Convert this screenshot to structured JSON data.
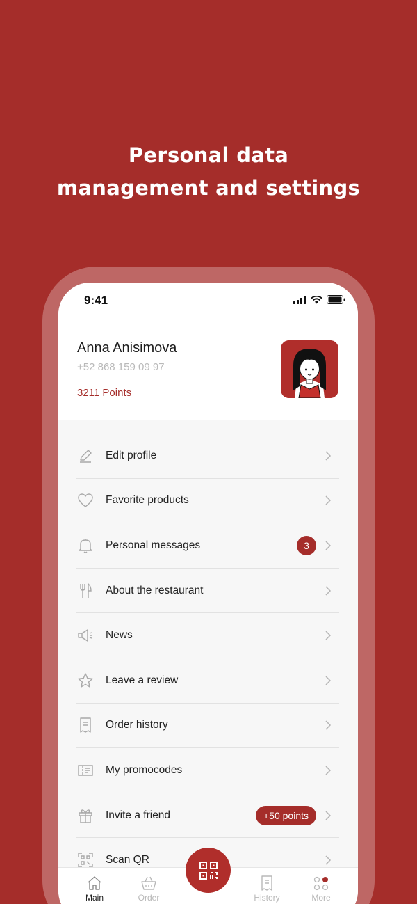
{
  "headline": {
    "line1": "Personal data",
    "line2": "management and settings"
  },
  "status_bar": {
    "time": "9:41"
  },
  "profile": {
    "name": "Anna Anisimova",
    "phone": "+52 868 159 09 97",
    "points": "3211 Points"
  },
  "menu": {
    "items": [
      {
        "label": "Edit profile",
        "icon": "pencil-icon"
      },
      {
        "label": "Favorite products",
        "icon": "heart-icon"
      },
      {
        "label": "Personal messages",
        "icon": "bell-icon",
        "badge": "3"
      },
      {
        "label": "About the restaurant",
        "icon": "fork-knife-icon"
      },
      {
        "label": "News",
        "icon": "megaphone-icon"
      },
      {
        "label": "Leave a review",
        "icon": "star-icon"
      },
      {
        "label": "Order history",
        "icon": "receipt-icon"
      },
      {
        "label": "My promocodes",
        "icon": "coupon-icon"
      },
      {
        "label": "Invite a friend",
        "icon": "gift-icon",
        "badge": "+50 points"
      },
      {
        "label": "Scan QR",
        "icon": "qr-scan-icon"
      }
    ]
  },
  "tabbar": {
    "tabs": [
      {
        "label": "Main",
        "icon": "home-icon",
        "active": true
      },
      {
        "label": "Order",
        "icon": "basket-icon",
        "active": false
      },
      {
        "label": "History",
        "icon": "receipt-icon",
        "active": false
      },
      {
        "label": "More",
        "icon": "more-dots-icon",
        "active": false
      }
    ]
  },
  "colors": {
    "brand": "#a52d2a",
    "background": "#f7f7f7",
    "muted_text": "#b9b9b9"
  }
}
